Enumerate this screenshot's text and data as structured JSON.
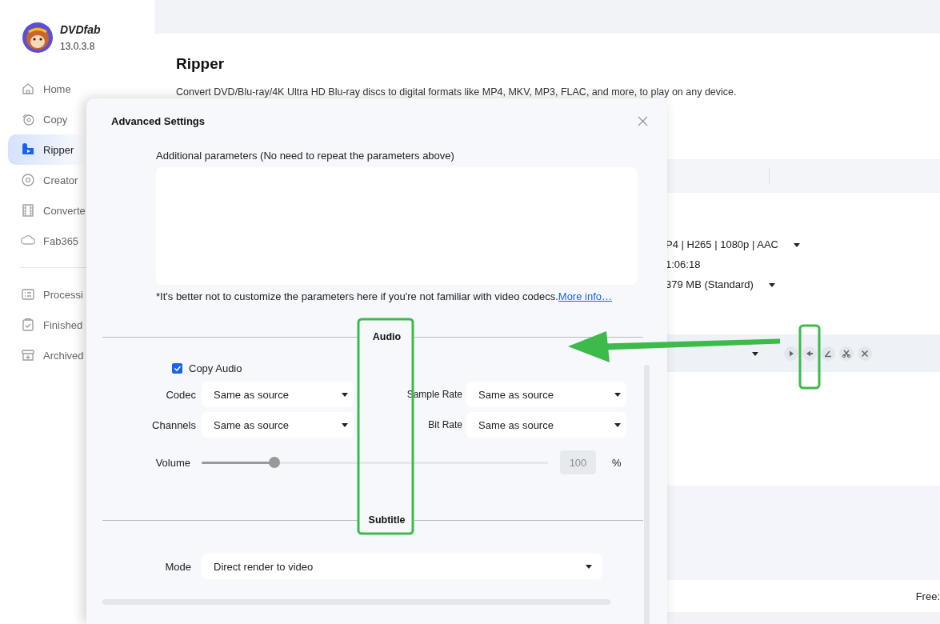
{
  "app": {
    "name": "DVDfab",
    "version": "13.0.3.8"
  },
  "sidebar": {
    "items": [
      {
        "label": "Home",
        "selected": false
      },
      {
        "label": "Copy",
        "selected": false
      },
      {
        "label": "Ripper",
        "selected": true
      },
      {
        "label": "Creator",
        "selected": false
      },
      {
        "label": "Converte",
        "selected": false
      },
      {
        "label": "Fab365",
        "selected": false
      }
    ],
    "task_items": [
      {
        "label": "Processi",
        "selected": false
      },
      {
        "label": "Finished",
        "selected": false
      },
      {
        "label": "Archived",
        "selected": false
      }
    ]
  },
  "main": {
    "title": "Ripper",
    "description": "Convert DVD/Blu-ray/4K Ultra HD Blu-ray discs to digital formats like MP4, MKV, MP3, FLAC, and more, to play on any device.",
    "details": [
      {
        "text": "P4 | H265 | 1080p | AAC",
        "dropdown": true
      },
      {
        "text": "1:06:18",
        "dropdown": false
      },
      {
        "text": "379 MB (Standard)",
        "dropdown": true
      }
    ],
    "status": "Free:"
  },
  "dialog": {
    "title": "Advanced Settings",
    "additional_label": "Additional parameters (No need to repeat the parameters above)",
    "note": "*It's better not to customize the parameters here if you're not familiar with video codecs.",
    "note_link": "More info…",
    "audio": {
      "heading": "Audio",
      "copy_audio": {
        "label": "Copy Audio",
        "checked": true
      },
      "fields": [
        {
          "label": "Codec",
          "value": "Same as source"
        },
        {
          "label": "Sample Rate",
          "value": "Same as source"
        },
        {
          "label": "Channels",
          "value": "Same as source"
        },
        {
          "label": "Bit Rate",
          "value": "Same as source"
        }
      ],
      "volume": {
        "label": "Volume",
        "level": 0.21,
        "value": "100",
        "unit": "%",
        "disabled": true
      }
    },
    "subtitle": {
      "heading": "Subtitle",
      "mode": {
        "label": "Mode",
        "value": "Direct render to video"
      }
    }
  }
}
